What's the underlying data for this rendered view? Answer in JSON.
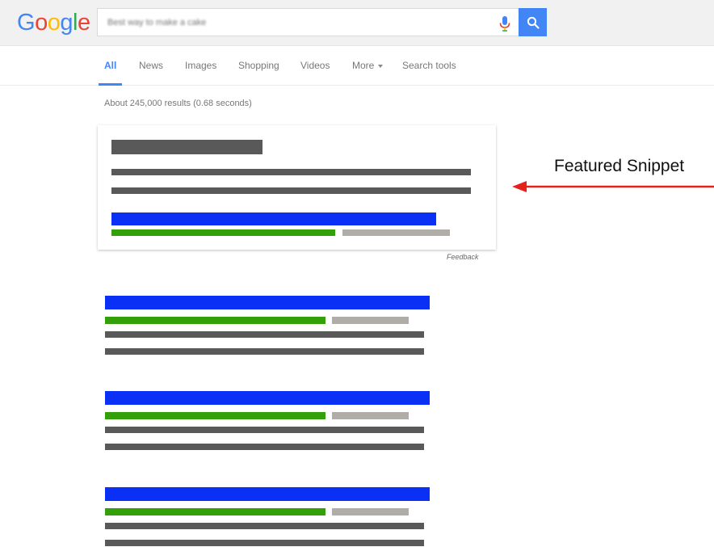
{
  "logo": {
    "letters": [
      "G",
      "o",
      "o",
      "g",
      "l",
      "e"
    ],
    "colors": [
      "#4285f4",
      "#ea4335",
      "#fbbc05",
      "#4285f4",
      "#34a853",
      "#ea4335"
    ]
  },
  "search": {
    "query": "Best way to make a cake",
    "mic_icon": "mic-icon",
    "search_icon": "search-icon"
  },
  "tabs": [
    {
      "label": "All",
      "active": true
    },
    {
      "label": "News",
      "active": false
    },
    {
      "label": "Images",
      "active": false
    },
    {
      "label": "Shopping",
      "active": false
    },
    {
      "label": "Videos",
      "active": false
    },
    {
      "label": "More",
      "active": false
    },
    {
      "label": "Search tools",
      "active": false
    }
  ],
  "result_stats": "About 245,000 results (0.68 seconds)",
  "featured_snippet": {
    "feedback_label": "Feedback"
  },
  "annotation": {
    "label": "Featured Snippet",
    "arrow_color": "#e8201c"
  },
  "colors": {
    "accent": "#4285f4",
    "title_bar": "#0a2ff5",
    "url_bar": "#33a009",
    "meta_bar": "#b0ada8",
    "text_bar": "#595959"
  }
}
